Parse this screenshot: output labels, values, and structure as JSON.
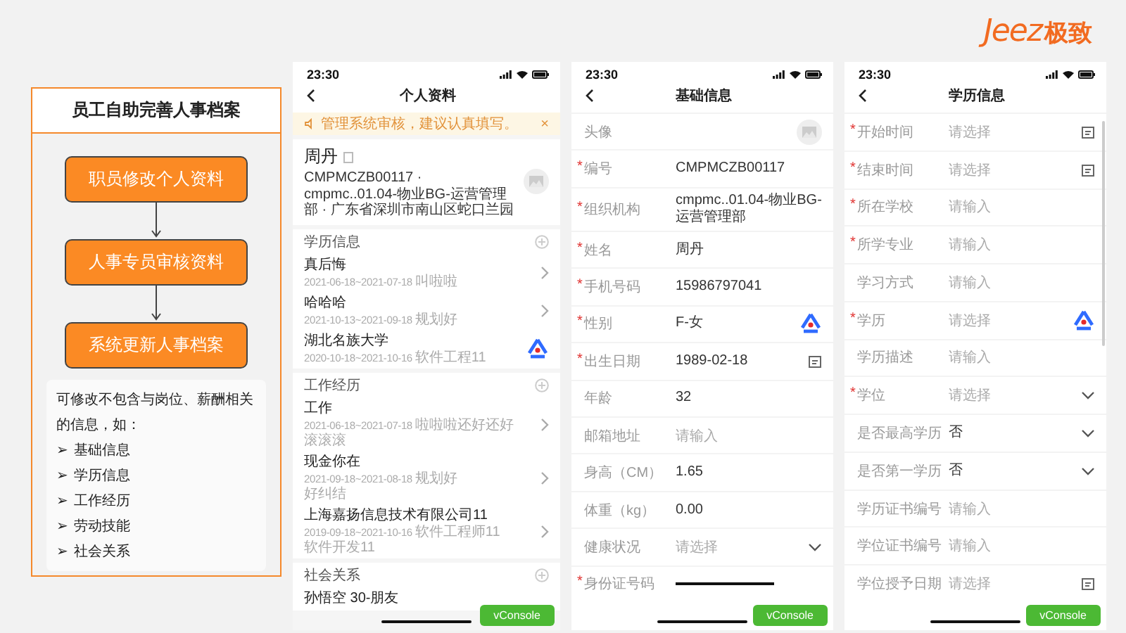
{
  "logo": {
    "latin": "Jeez",
    "chinese": "极致"
  },
  "flow": {
    "title": "员工自助完善人事档案",
    "steps": [
      "职员修改个人资料",
      "人事专员审核资料",
      "系统更新人事档案"
    ],
    "note": "可修改不包含与岗位、薪酬相关的信息，如：",
    "bullets": [
      {
        "marker": "➢",
        "text": "基础信息"
      },
      {
        "marker": "➢",
        "text": "学历信息"
      },
      {
        "marker": "➢",
        "text": "工作经历"
      },
      {
        "marker": "➢",
        "text": "劳动技能"
      },
      {
        "marker": "➢",
        "text": "社会关系"
      }
    ]
  },
  "phones": [
    {
      "kind": "profile",
      "time": "23:30",
      "title": "个人资料",
      "notice": "管理系统审核，建议认真填写。",
      "notice_close": "×",
      "person": {
        "name": "周丹",
        "details": "CMPMCZB00117 · cmpmc..01.04-物业BG-运营管理部 · 广东省深圳市南山区蛇口兰园"
      },
      "sections": [
        {
          "title": "学历信息",
          "items": [
            {
              "kind": "link",
              "title": "真后悔",
              "dates": "2021-06-18~2021-07-18",
              "note": "叫啦啦",
              "badge": false
            },
            {
              "kind": "link",
              "title": "哈哈哈",
              "dates": "2021-10-13~2021-09-18",
              "note": "规划好",
              "badge": false
            },
            {
              "kind": "link",
              "title": "湖北名族大学",
              "dates": "2020-10-18~2021-10-16",
              "note": "软件工程11",
              "badge": true
            }
          ]
        },
        {
          "title": "工作经历",
          "items": [
            {
              "kind": "link",
              "title": "工作",
              "dates": "2021-06-18~2021-07-18",
              "note": "啦啦啦还好还好",
              "extra": "滚滚滚",
              "badge": false
            },
            {
              "kind": "link",
              "title": "现金你在",
              "dates": "2021-09-18~2021-08-18",
              "note": "规划好",
              "extra": "好纠结",
              "badge": false
            },
            {
              "kind": "link",
              "title": "上海嘉扬信息技术有限公司11",
              "dates": "2019-09-18~2021-10-16",
              "note": "软件工程师11",
              "extra": "软件开发11",
              "badge": false
            }
          ]
        },
        {
          "title": "社会关系",
          "items": [
            {
              "kind": "plain",
              "title": "孙悟空 30-朋友",
              "badge": false
            }
          ]
        }
      ],
      "vconsole": "vConsole"
    },
    {
      "kind": "form",
      "time": "23:30",
      "title": "基础信息",
      "rows": [
        {
          "kind": "avatar",
          "label": "头像",
          "badge": false
        },
        {
          "kind": "text",
          "mark": "*",
          "label": "编号",
          "value": "CMPMCZB00117",
          "badge": false
        },
        {
          "kind": "text",
          "mark": "*",
          "label": "组织机构",
          "value": "cmpmc..01.04-物业BG-运营管理部",
          "badge": false
        },
        {
          "kind": "text",
          "mark": "*",
          "label": "姓名",
          "value": "周丹",
          "badge": false
        },
        {
          "kind": "text",
          "mark": "*",
          "label": "手机号码",
          "value": "15986797041",
          "badge": false
        },
        {
          "kind": "text",
          "mark": "*",
          "label": "性别",
          "value": "F-女",
          "badge": true
        },
        {
          "kind": "date",
          "mark": "*",
          "label": "出生日期",
          "value": "1989-02-18",
          "badge": false
        },
        {
          "kind": "text",
          "label": "年龄",
          "value": "32",
          "badge": false
        },
        {
          "kind": "text",
          "label": "邮箱地址",
          "placeholder": "请输入",
          "badge": false
        },
        {
          "kind": "text",
          "label": "身高（CM）",
          "value": "1.65",
          "badge": false
        },
        {
          "kind": "text",
          "label": "体重（kg）",
          "value": "0.00",
          "badge": false
        },
        {
          "kind": "select",
          "label": "健康状况",
          "placeholder": "请选择",
          "badge": false
        },
        {
          "kind": "text",
          "mark": "*",
          "label": "身份证号码",
          "redacted": true,
          "badge": false
        }
      ],
      "vconsole": "vConsole"
    },
    {
      "kind": "form",
      "time": "23:30",
      "title": "学历信息",
      "rows": [
        {
          "kind": "date",
          "mark": "*",
          "label": "开始时间",
          "placeholder": "请选择",
          "badge": false
        },
        {
          "kind": "date",
          "mark": "*",
          "label": "结束时间",
          "placeholder": "请选择",
          "badge": false
        },
        {
          "kind": "text",
          "mark": "*",
          "label": "所在学校",
          "placeholder": "请输入",
          "badge": false
        },
        {
          "kind": "text",
          "mark": "*",
          "label": "所学专业",
          "placeholder": "请输入",
          "badge": false
        },
        {
          "kind": "text",
          "label": "学习方式",
          "placeholder": "请输入",
          "badge": false
        },
        {
          "kind": "text",
          "mark": "*",
          "label": "学历",
          "placeholder": "请选择",
          "badge": true
        },
        {
          "kind": "text",
          "label": "学历描述",
          "placeholder": "请输入",
          "badge": false
        },
        {
          "kind": "select",
          "mark": "*",
          "label": "学位",
          "placeholder": "请选择",
          "badge": false
        },
        {
          "kind": "select",
          "label": "是否最高学历",
          "value": "否",
          "badge": false
        },
        {
          "kind": "select",
          "label": "是否第一学历",
          "value": "否",
          "badge": false
        },
        {
          "kind": "text",
          "label": "学历证书编号",
          "placeholder": "请输入",
          "badge": false
        },
        {
          "kind": "text",
          "label": "学位证书编号",
          "placeholder": "请输入",
          "badge": false
        },
        {
          "kind": "date",
          "label": "学位授予日期",
          "placeholder": "请选择",
          "badge": false
        }
      ],
      "vconsole": "vConsole"
    }
  ]
}
